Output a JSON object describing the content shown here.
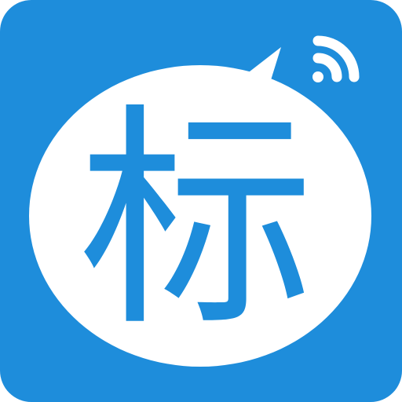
{
  "app_icon": {
    "glyph": "标",
    "background_color": "#1E8DDB",
    "bubble_color": "#FFFFFF",
    "glyph_color": "#1E8DDB",
    "signal_color": "#FFFFFF",
    "icons": [
      "chat-bubble-icon",
      "wifi-signal-icon"
    ]
  }
}
